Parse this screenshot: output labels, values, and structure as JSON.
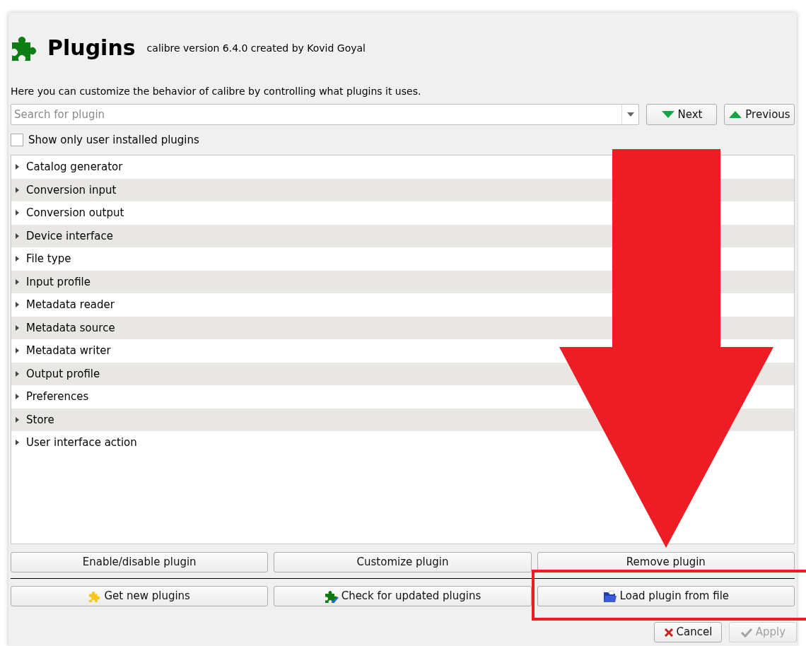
{
  "header": {
    "title": "Plugins",
    "subtitle": "calibre version 6.4.0 created by Kovid Goyal"
  },
  "description": "Here you can customize the behavior of calibre by controlling what plugins it uses.",
  "search": {
    "placeholder": "Search for plugin"
  },
  "nav_buttons": [
    {
      "label": "Next"
    },
    {
      "label": "Previous"
    }
  ],
  "filter": {
    "label": "Show only user installed plugins",
    "checked": false
  },
  "categories": [
    {
      "label": "Catalog generator",
      "expanded": false
    },
    {
      "label": "Conversion input",
      "expanded": false
    },
    {
      "label": "Conversion output",
      "expanded": false
    },
    {
      "label": "Device interface",
      "expanded": false
    },
    {
      "label": "File type",
      "expanded": false
    },
    {
      "label": "Input profile",
      "expanded": false
    },
    {
      "label": "Metadata reader",
      "expanded": false
    },
    {
      "label": "Metadata source",
      "expanded": false
    },
    {
      "label": "Metadata writer",
      "expanded": false
    },
    {
      "label": "Output profile",
      "expanded": false
    },
    {
      "label": "Preferences",
      "expanded": false
    },
    {
      "label": "Store",
      "expanded": false
    },
    {
      "label": "User interface action",
      "expanded": false
    }
  ],
  "plugin_buttons": [
    {
      "label": "Enable/disable plugin"
    },
    {
      "label": "Customize plugin"
    },
    {
      "label": "Remove plugin"
    }
  ],
  "source_buttons": [
    {
      "label": "Get new plugins"
    },
    {
      "label": "Check for updated plugins"
    },
    {
      "label": "Load plugin from file"
    }
  ],
  "dialog_buttons": [
    {
      "label": "Cancel",
      "disabled": false
    },
    {
      "label": "Apply",
      "disabled": true
    }
  ]
}
